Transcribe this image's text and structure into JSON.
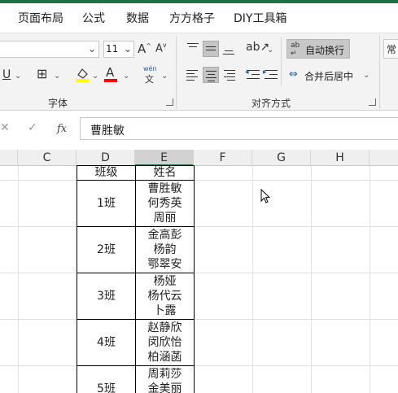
{
  "tabs": [
    "页面布局",
    "公式",
    "数据",
    "方方格子",
    "DIY工具箱"
  ],
  "ribbon": {
    "font_size": "11",
    "underline_label": "U",
    "font_group_label": "字体",
    "align_group_label": "对齐方式",
    "wrap_text_label": "自动换行",
    "merge_center_label": "合并后居中",
    "cut_right_label": "常",
    "phonetic_label": "wén",
    "phonetic_char": "文",
    "font_color_label": "A",
    "highlight_color": "#ffff00",
    "font_color": "#ff0000"
  },
  "formula_bar": {
    "fx_label": "fx",
    "content": "曹胜敏"
  },
  "columns": [
    "C",
    "D",
    "E",
    "F",
    "G",
    "H"
  ],
  "table": {
    "header": [
      "班级",
      "姓名"
    ],
    "rows": [
      {
        "class": "1班",
        "names": [
          "曹胜敏",
          "何秀英",
          "周丽"
        ]
      },
      {
        "class": "2班",
        "names": [
          "金高彭",
          "杨韵",
          "鄂翠安"
        ]
      },
      {
        "class": "3班",
        "names": [
          "杨娅",
          "杨代云",
          "卜露"
        ]
      },
      {
        "class": "4班",
        "names": [
          "赵静欣",
          "闵欣怡",
          "柏涵菡"
        ]
      },
      {
        "class": "5班",
        "names": [
          "周莉莎",
          "金美丽"
        ]
      }
    ]
  }
}
